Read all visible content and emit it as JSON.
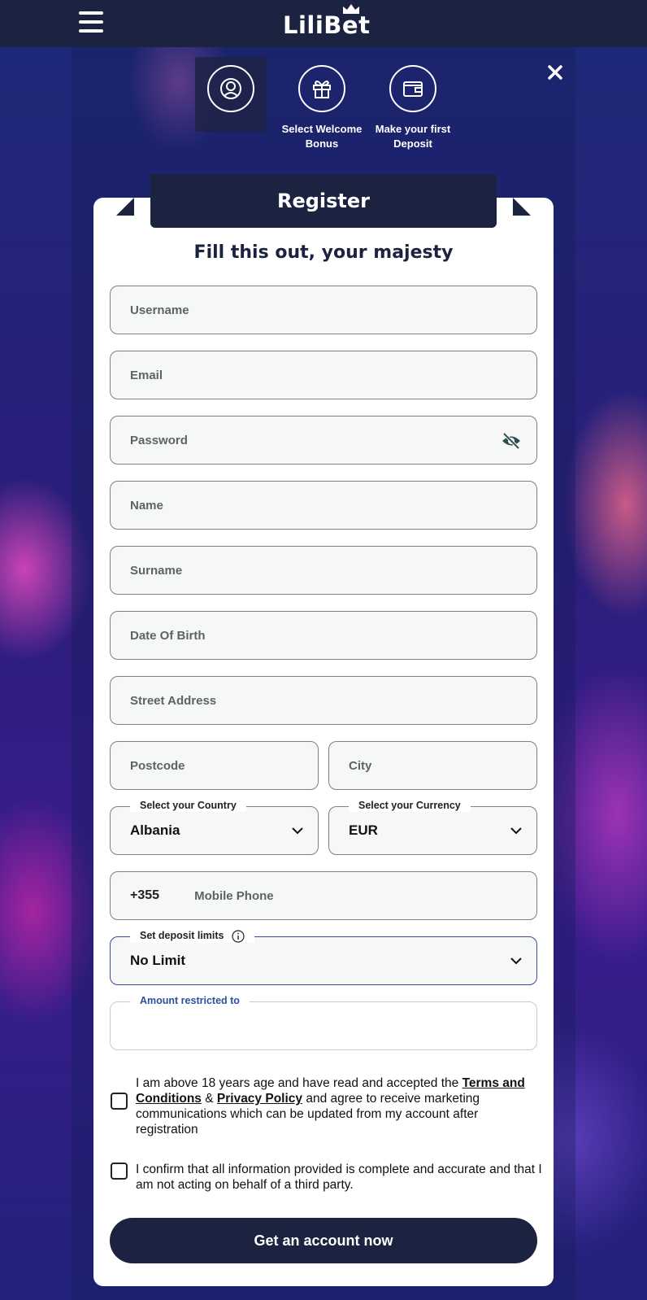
{
  "header": {
    "brand": "LiliBet"
  },
  "steps": [
    {
      "icon": "user-icon",
      "label": ""
    },
    {
      "icon": "gift-icon",
      "label": "Select Welcome Bonus"
    },
    {
      "icon": "wallet-icon",
      "label": "Make your first Deposit"
    }
  ],
  "form": {
    "ribbon_title": "Register",
    "subtitle": "Fill this out, your majesty",
    "username_placeholder": "Username",
    "email_placeholder": "Email",
    "password_placeholder": "Password",
    "name_placeholder": "Name",
    "surname_placeholder": "Surname",
    "dob_placeholder": "Date Of Birth",
    "street_placeholder": "Street Address",
    "postcode_placeholder": "Postcode",
    "city_placeholder": "City",
    "country_legend": "Select your Country",
    "country_value": "Albania",
    "currency_legend": "Select your Currency",
    "currency_value": "EUR",
    "phone_prefix": "+355",
    "phone_placeholder": "Mobile Phone",
    "deposit_legend": "Set deposit limits",
    "deposit_value": "No Limit",
    "amount_legend": "Amount restricted to",
    "amount_value": ""
  },
  "consent": {
    "age_text_1": "I am above 18 years age and have read and accepted the ",
    "terms_link": "Terms and Conditions",
    "amp": " & ",
    "privacy_link": "Privacy Policy",
    "age_text_2": " and agree to receive marketing communications which can be updated from my account after registration",
    "confirm_text": "I confirm that all information provided is complete and accurate and that I am not acting on behalf of a third party."
  },
  "submit_label": "Get an account now",
  "colors": {
    "navy": "#1c2340",
    "field_bg": "#f6f7f7",
    "accent_blue": "#2f4ea0"
  }
}
